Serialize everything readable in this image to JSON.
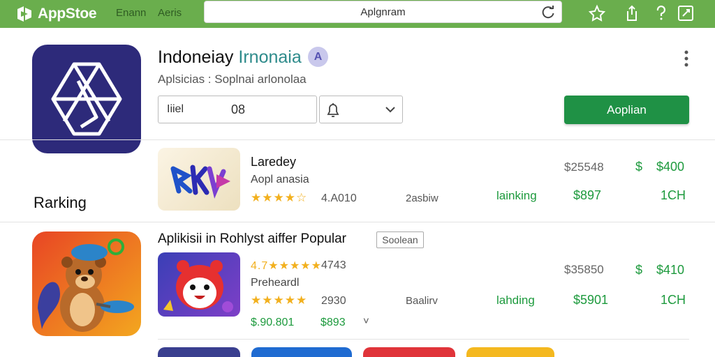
{
  "topbar": {
    "brand": "AppStoe",
    "links": [
      "Enann",
      "Aeris"
    ],
    "search_value": "Aplgnram",
    "icons": [
      "refresh-icon",
      "share-up-icon",
      "help-icon",
      "external-edit-icon",
      "star-outline-icon"
    ]
  },
  "header": {
    "title_main": "Indoneiay",
    "title_accent": "Irnonaia",
    "subtitle": "Aplsicias : Soplnai arlonolaa",
    "field_label": "Iiiel",
    "field_value": "08",
    "install_label": "Aoplian"
  },
  "ranking_label": "Rarking",
  "row1": {
    "title": "Laredey",
    "subtitle": "Aopl anasia",
    "stars": "★★★★☆",
    "rating": "4.A010",
    "meta": "2asbiw",
    "status": "lainking",
    "price_gray": "$25548",
    "price_green": "$897",
    "dollar_sign": "$",
    "price_right": "$400",
    "extra": "1CH"
  },
  "section": {
    "title": "Aplikisii in Rohlyst aiffer Popular",
    "chip": "Soolean"
  },
  "row2": {
    "rating_top": "4.7",
    "stars_top": "★★★★★",
    "rating_top_num": "4743",
    "subtitle": "Preheardl",
    "stars_mid": "★★★★★",
    "rating_mid": "2930",
    "meta": "Baalirv",
    "status": "lahding",
    "price_gray": "$35850",
    "price_green": "$5901",
    "dollar_sign": "$",
    "price_right": "$410",
    "extra": "1CH",
    "price_bottom_green": "$.90.801",
    "price_bottom_2": "$893",
    "chev": "˅"
  },
  "colors": {
    "brand_green": "#6aae4d",
    "install_green": "#1f9145",
    "price_green": "#1d9a3d",
    "star_gold": "#f2b01e",
    "app_icon_navy": "#2d2a7a"
  }
}
